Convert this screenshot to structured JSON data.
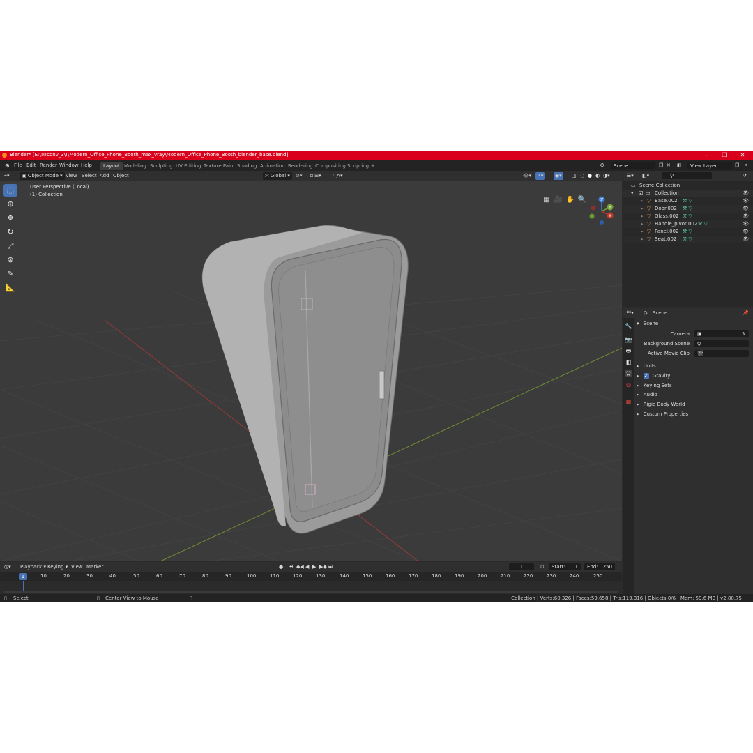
{
  "window": {
    "title": "Blender* [E:\\!!!conv_3\\!\\Modern_Office_Phone_Booth_max_vray\\Modern_Office_Phone_Booth_blender_base.blend]",
    "minimize": "–",
    "maximize": "❐",
    "close": "✕"
  },
  "menu": {
    "file": "File",
    "edit": "Edit",
    "render": "Render",
    "window": "Window",
    "help": "Help"
  },
  "workspaces": [
    "Layout",
    "Modeling",
    "Sculpting",
    "UV Editing",
    "Texture Paint",
    "Shading",
    "Animation",
    "Rendering",
    "Compositing",
    "Scripting"
  ],
  "add_workspace": "+",
  "scene_selector": "Scene",
  "view_layer": "View Layer",
  "viewport_header": {
    "mode": "Object Mode",
    "view": "View",
    "select": "Select",
    "add": "Add",
    "object": "Object",
    "transform_orientation": "Global"
  },
  "viewport": {
    "perspective": "User Perspective (Local)",
    "collection": "(1) Collection",
    "gizmo": {
      "z": "Z",
      "y": "Y",
      "x": "X"
    }
  },
  "outliner": {
    "root": "Scene Collection",
    "collection": "Collection",
    "items": [
      "Base.002",
      "Door.002",
      "Glass.002",
      "Handle_pivot.002",
      "Panel.002",
      "Seat.002"
    ]
  },
  "properties": {
    "header": "Scene",
    "panel_title": "Scene",
    "camera_label": "Camera",
    "background_label": "Background Scene",
    "movieclip_label": "Active Movie Clip",
    "sections": [
      "Units",
      "Gravity",
      "Keying Sets",
      "Audio",
      "Rigid Body World",
      "Custom Properties"
    ],
    "gravity_checked": true
  },
  "timeline": {
    "playback": "Playback",
    "keying": "Keying",
    "view": "View",
    "marker": "Marker",
    "current_frame": "1",
    "start_label": "Start:",
    "start": "1",
    "end_label": "End:",
    "end": "250",
    "ruler_current": "1",
    "ruler": [
      "10",
      "20",
      "30",
      "40",
      "50",
      "60",
      "70",
      "80",
      "90",
      "100",
      "110",
      "120",
      "130",
      "140",
      "150",
      "160",
      "170",
      "180",
      "190",
      "200",
      "210",
      "220",
      "230",
      "240",
      "250"
    ]
  },
  "status": {
    "select": "Select",
    "center": "Center View to Mouse",
    "stats": "Collection | Verts:60,326 | Faces:59,658 | Tris:119,316 | Objects:0/6 | Mem: 59.6 MB | v2.80.75"
  },
  "colors": {
    "title_bar": "#d9001b",
    "active_tool": "#4772b3",
    "axis_x": "#c0392b",
    "axis_y": "#7aa33a",
    "axis_z": "#3f7fd9",
    "mesh_icon": "#e38a3a",
    "data_icon": "#56c2a6"
  }
}
